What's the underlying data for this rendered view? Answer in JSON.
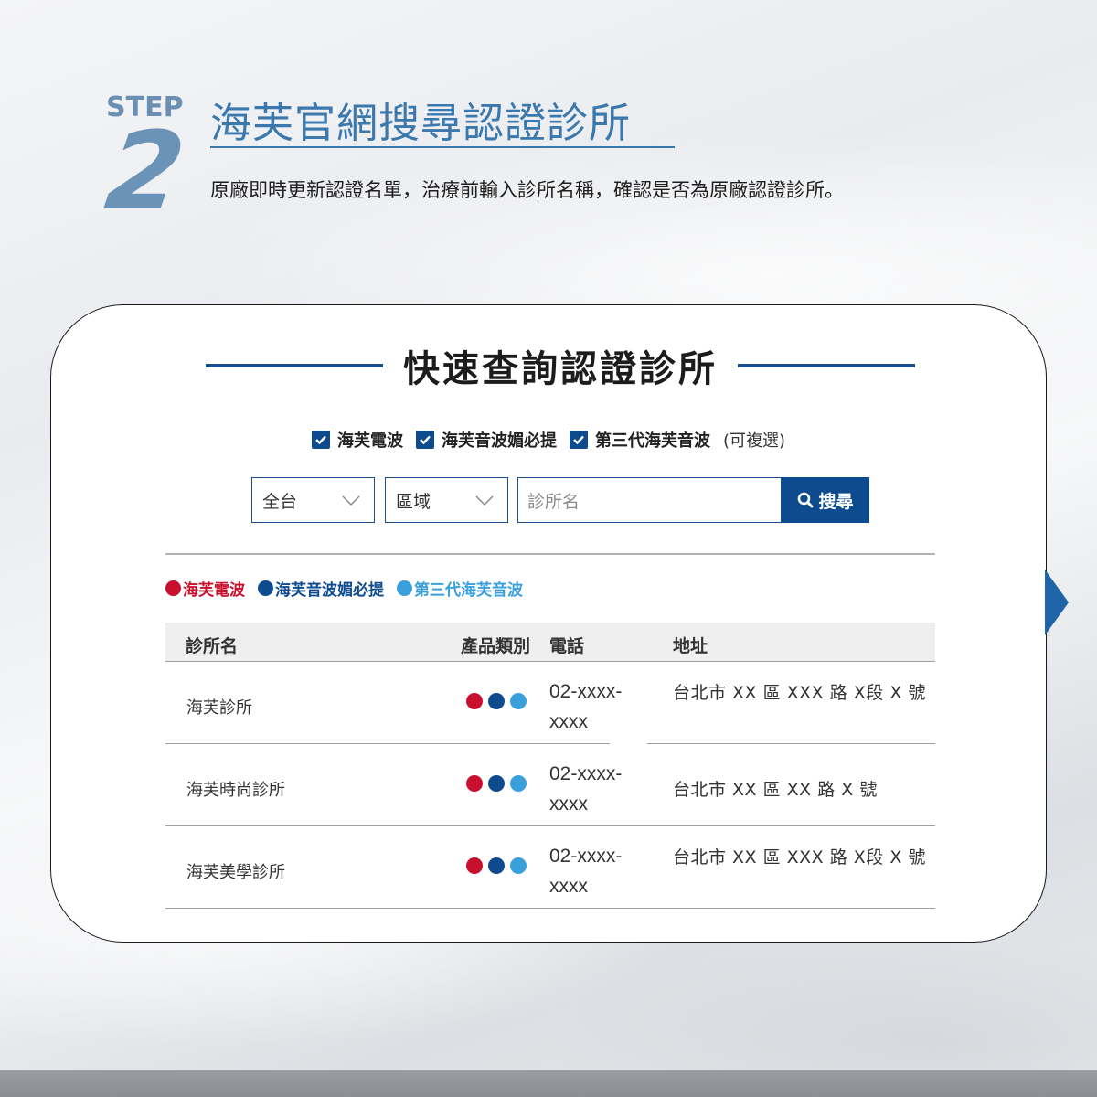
{
  "header": {
    "step_label": "STEP",
    "step_number": "2",
    "title": "海芙官網搜尋認證診所",
    "subtitle": "原廠即時更新認證名單，治療前輸入診所名稱，確認是否為原廠認證診所。"
  },
  "card": {
    "heading": "快速查詢認證診所",
    "filters": [
      {
        "label": "海芙電波",
        "checked": true
      },
      {
        "label": "海芙音波媚必提",
        "checked": true
      },
      {
        "label": "第三代海芙音波",
        "checked": true
      }
    ],
    "filters_note": "(可複選)",
    "search": {
      "region_select": "全台",
      "district_select": "區域",
      "clinic_placeholder": "診所名",
      "button_label": "搜尋"
    },
    "legend": [
      {
        "label": "海芙電波",
        "color": "#c8102e"
      },
      {
        "label": "海芙音波媚必提",
        "color": "#0d4a8e"
      },
      {
        "label": "第三代海芙音波",
        "color": "#3aa0dc"
      }
    ],
    "table": {
      "columns": [
        "診所名",
        "產品類別",
        "電話",
        "地址"
      ],
      "rows": [
        {
          "name": "海芙診所",
          "phone_line1": "02-xxxx-",
          "phone_line2": "xxxx",
          "address": "台北市 XX 區 XXX 路 X段 X 號",
          "products": [
            "#c8102e",
            "#0d4a8e",
            "#3aa0dc"
          ]
        },
        {
          "name": "海芙時尚診所",
          "phone_line1": "02-xxxx-",
          "phone_line2": "xxxx",
          "address": "台北市 XX 區 XX 路 X 號",
          "products": [
            "#c8102e",
            "#0d4a8e",
            "#3aa0dc"
          ]
        },
        {
          "name": "海芙美學診所",
          "phone_line1": "02-xxxx-",
          "phone_line2": "xxxx",
          "address": "台北市 XX 區 XXX 路 X段 X 號",
          "products": [
            "#c8102e",
            "#0d4a8e",
            "#3aa0dc"
          ]
        }
      ]
    }
  }
}
